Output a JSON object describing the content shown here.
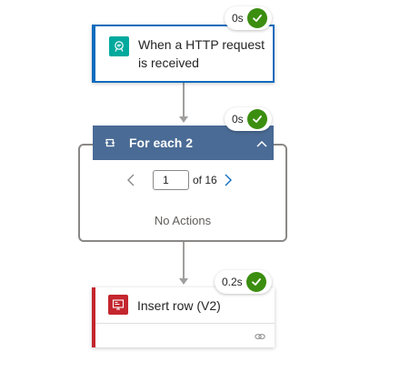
{
  "trigger": {
    "title": "When a HTTP request is received",
    "status_time": "0s",
    "status": "succeeded",
    "icon": "http-request-icon"
  },
  "foreach": {
    "title": "For each 2",
    "status_time": "0s",
    "status": "succeeded",
    "icon": "loop-icon",
    "collapse_icon": "chevron-up-icon",
    "page": {
      "current": "1",
      "of_label": "of 16",
      "prev_icon": "chevron-left-icon",
      "next_icon": "chevron-right-icon"
    },
    "empty_text": "No Actions"
  },
  "insert_row": {
    "title": "Insert row (V2)",
    "status_time": "0.2s",
    "status": "succeeded",
    "icon": "sql-server-icon",
    "footer_icon": "link-icon"
  },
  "colors": {
    "trigger_border": "#0f6cbd",
    "trigger_icon_bg": "#00a99d",
    "scope_header_bg": "#4a6b95",
    "insert_accent": "#c4262e",
    "success_green": "#3b8e10",
    "connector": "#a19f9d"
  }
}
